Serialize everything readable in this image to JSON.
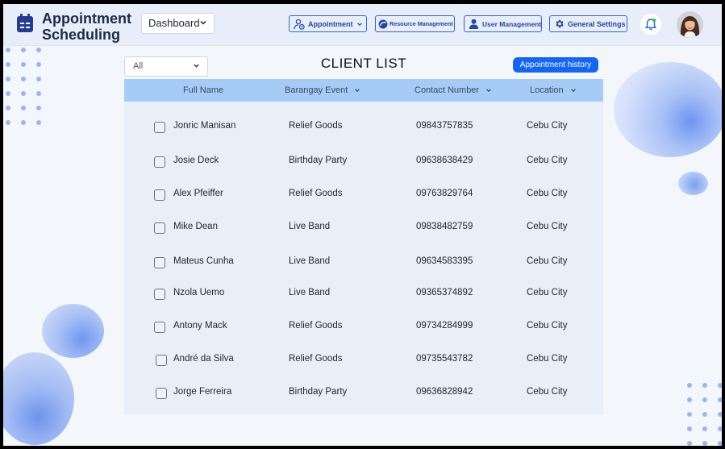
{
  "header": {
    "app_title": "Appointment Scheduling",
    "dashboard_select": "Dashboard",
    "nav": {
      "appointment": "Appointment",
      "resource": "Resource Management",
      "user": "User Management",
      "settings": "General Settings"
    }
  },
  "toolbar": {
    "filter_value": "All",
    "page_title": "CLIENT LIST",
    "history_button": "Appointment history"
  },
  "table": {
    "columns": {
      "name": "Full Name",
      "event": "Barangay Event",
      "contact": "Contact Number",
      "location": "Location"
    },
    "rows": [
      {
        "name": "Jonric Manisan",
        "event": "Relief Goods",
        "contact": "09843757835",
        "location": "Cebu City"
      },
      {
        "name": "Josie Deck",
        "event": "Birthday Party",
        "contact": "09638638429",
        "location": "Cebu City"
      },
      {
        "name": "Alex Pfeiffer",
        "event": "Relief Goods",
        "contact": "09763829764",
        "location": "Cebu City"
      },
      {
        "name": "Mike Dean",
        "event": "Live Band",
        "contact": "09838482759",
        "location": "Cebu City"
      },
      {
        "name": "Mateus Cunha",
        "event": "Live Band",
        "contact": "09634583395",
        "location": "Cebu City"
      },
      {
        "name": "Nzola Uemo",
        "event": "Live Band",
        "contact": "09365374892",
        "location": "Cebu City"
      },
      {
        "name": "Antony Mack",
        "event": "Relief Goods",
        "contact": "09734284999",
        "location": "Cebu City"
      },
      {
        "name": "André da Silva",
        "event": "Relief Goods",
        "contact": "09735543782",
        "location": "Cebu City"
      },
      {
        "name": "Jorge Ferreira",
        "event": "Birthday Party",
        "contact": "09636828942",
        "location": "Cebu City"
      }
    ]
  },
  "colors": {
    "accent": "#1565ee",
    "header_bg": "#e7eef9",
    "table_header": "#a6cbf7",
    "table_bg": "#e8eff9"
  }
}
